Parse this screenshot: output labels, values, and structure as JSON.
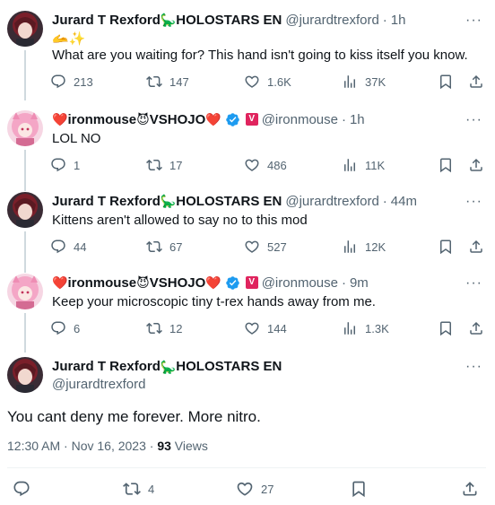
{
  "tweets": [
    {
      "name": "Jurard T Rexford",
      "name_suffix": "HOLOSTARS EN",
      "handle": "@jurardtrexford",
      "time": "1h",
      "text_emoji": "🫴✨",
      "text": "What are you waiting for? This hand isn't going to kiss itself you know.",
      "replies": "213",
      "retweets": "147",
      "likes": "1.6K",
      "views": "37K"
    },
    {
      "name": "ironmouse",
      "name_suffix": "VSHOJO",
      "handle": "@ironmouse",
      "time": "1h",
      "text": "LOL NO",
      "replies": "1",
      "retweets": "17",
      "likes": "486",
      "views": "11K"
    },
    {
      "name": "Jurard T Rexford",
      "name_suffix": "HOLOSTARS EN",
      "handle": "@jurardtrexford",
      "time": "44m",
      "text": "Kittens aren't allowed to say no to this mod",
      "replies": "44",
      "retweets": "67",
      "likes": "527",
      "views": "12K"
    },
    {
      "name": "ironmouse",
      "name_suffix": "VSHOJO",
      "handle": "@ironmouse",
      "time": "9m",
      "text": "Keep your microscopic tiny t-rex hands away from me.",
      "replies": "6",
      "retweets": "12",
      "likes": "144",
      "views": "1.3K"
    }
  ],
  "main_tweet": {
    "name": "Jurard T Rexford",
    "name_suffix": "HOLOSTARS EN",
    "handle": "@jurardtrexford",
    "text": "You cant deny me forever. More nitro.",
    "timestamp": "12:30 AM · Nov 16, 2023 · ",
    "views_count": "93",
    "views_label": " Views",
    "retweets": "4",
    "likes": "27"
  },
  "icons": {
    "reply": "reply-icon",
    "retweet": "retweet-icon",
    "like": "heart-icon",
    "views": "views-icon",
    "bookmark": "bookmark-icon",
    "share": "share-icon",
    "more": "more-icon"
  },
  "colors": {
    "text": "#0f1419",
    "secondary": "#536471",
    "verified": "#1d9bf0",
    "vshojo_badge": "#e0245e",
    "heart_emoji": "#e0245e"
  },
  "more_glyph": "···",
  "badge_v_letter": "V",
  "dino": "🦕",
  "heart": "❤️",
  "devil": "😈"
}
